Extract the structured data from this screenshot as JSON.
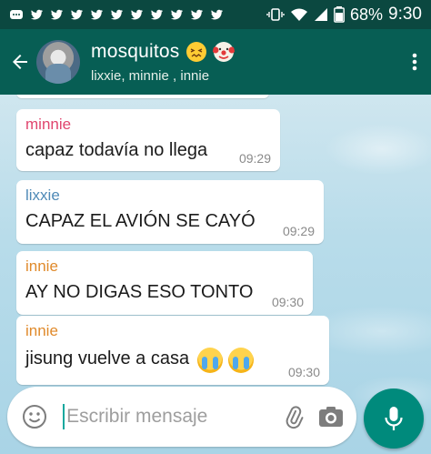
{
  "status_bar": {
    "battery": "68%",
    "time": "9:30",
    "icons": [
      "messages-icon",
      "twitter-icon",
      "twitter-icon",
      "twitter-icon",
      "twitter-icon",
      "twitter-icon",
      "twitter-icon",
      "twitter-icon",
      "twitter-icon",
      "twitter-icon",
      "twitter-icon",
      "vibrate-icon",
      "wifi-icon",
      "signal-icon",
      "battery-icon"
    ]
  },
  "header": {
    "title": "mosquitos",
    "title_emojis": [
      "confounded-face-emoji",
      "clown-face-emoji"
    ],
    "subtitle": "lixxie, minnie , innie"
  },
  "messages": [
    {
      "sender": "minnie",
      "text": "capaz todavía no llega",
      "time": "09:29"
    },
    {
      "sender": "lixxie",
      "text": "CAPAZ EL AVIÓN SE CAYÓ",
      "time": "09:29"
    },
    {
      "sender": "innie",
      "text": "AY NO DIGAS ESO TONTO",
      "time": "09:30"
    },
    {
      "sender": "innie",
      "text": "jisung vuelve a casa",
      "emojis": [
        "loudly-crying-face-emoji",
        "loudly-crying-face-emoji"
      ],
      "time": "09:30"
    }
  ],
  "composer": {
    "placeholder": "Escribir mensaje",
    "value": ""
  },
  "colors": {
    "header": "#075e54",
    "status_bar": "#0b4840",
    "accent": "#008a7c",
    "minnie": "#e0456e",
    "lixxie": "#4f8ab7",
    "innie": "#e08a2b"
  }
}
